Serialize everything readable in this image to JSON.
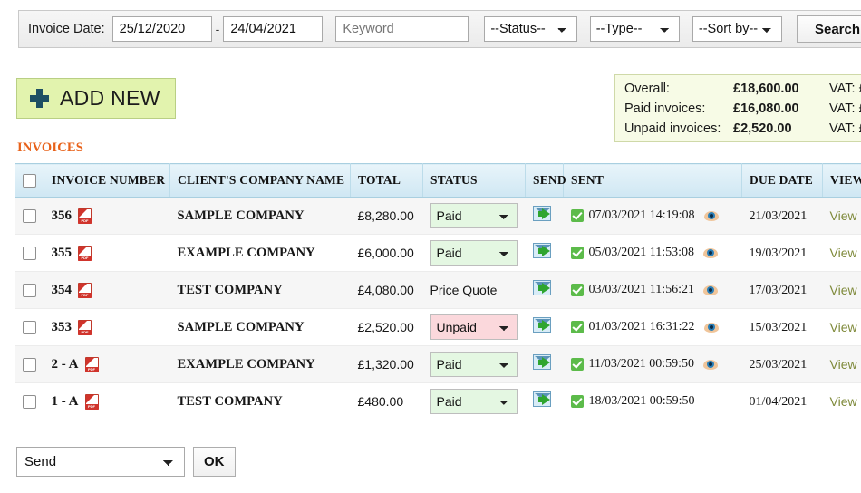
{
  "filters": {
    "invoice_date_label": "Invoice Date:",
    "date_from": "25/12/2020",
    "date_separator": "-",
    "date_to": "24/04/2021",
    "keyword_placeholder": "Keyword",
    "keyword_value": "",
    "status_select": "--Status--",
    "type_select": "--Type--",
    "sort_select": "--Sort by--",
    "search_button": "Search"
  },
  "add_new": {
    "label": "ADD NEW",
    "icon": "plus-icon"
  },
  "totals": {
    "rows": [
      {
        "label": "Overall:",
        "amount": "£18,600.00",
        "vat": "VAT: £"
      },
      {
        "label": "Paid invoices:",
        "amount": "£16,080.00",
        "vat": "VAT: £"
      },
      {
        "label": "Unpaid invoices:",
        "amount": "£2,520.00",
        "vat": "VAT: £"
      }
    ]
  },
  "section_title": "INVOICES",
  "table": {
    "headers": [
      "",
      "INVOICE NUMBER",
      "CLIENT'S COMPANY NAME",
      "TOTAL",
      "STATUS",
      "SEND",
      "SENT",
      "DUE DATE",
      "VIEW"
    ],
    "rows": [
      {
        "number": "356",
        "company": "SAMPLE COMPANY",
        "total": "£8,280.00",
        "status": "Paid",
        "status_type": "select",
        "status_color": "#e4f7e2",
        "sent": "07/03/2021 14:19:08",
        "has_eye": true,
        "due_date": "21/03/2021",
        "view": "View"
      },
      {
        "number": "355",
        "company": "EXAMPLE COMPANY",
        "total": "£6,000.00",
        "status": "Paid",
        "status_type": "select",
        "status_color": "#e4f7e2",
        "sent": "05/03/2021 11:53:08",
        "has_eye": true,
        "due_date": "19/03/2021",
        "view": "View"
      },
      {
        "number": "354",
        "company": "TEST COMPANY",
        "total": "£4,080.00",
        "status": "Price Quote",
        "status_type": "text",
        "status_color": "",
        "sent": "03/03/2021 11:56:21",
        "has_eye": true,
        "due_date": "17/03/2021",
        "view": "View"
      },
      {
        "number": "353",
        "company": "SAMPLE COMPANY",
        "total": "£2,520.00",
        "status": "Unpaid",
        "status_type": "select",
        "status_color": "#fbd8dc",
        "sent": "01/03/2021 16:31:22",
        "has_eye": true,
        "due_date": "15/03/2021",
        "view": "View"
      },
      {
        "number": "2 - A",
        "company": "EXAMPLE COMPANY",
        "total": "£1,320.00",
        "status": "Paid",
        "status_type": "select",
        "status_color": "#e4f7e2",
        "sent": "11/03/2021 00:59:50",
        "has_eye": true,
        "due_date": "25/03/2021",
        "view": "View"
      },
      {
        "number": "1 - A",
        "company": "TEST COMPANY",
        "total": "£480.00",
        "status": "Paid",
        "status_type": "select",
        "status_color": "#e4f7e2",
        "sent": "18/03/2021 00:59:50",
        "has_eye": false,
        "due_date": "01/04/2021",
        "view": "View"
      }
    ]
  },
  "bulk": {
    "action": "Send",
    "ok_button": "OK"
  },
  "colors": {
    "accent_orange": "#e8621a",
    "add_new_bg": "#e2f3ae",
    "totals_bg": "#f7fbe6",
    "header_bg": "#cfe7f3",
    "paid_bg": "#e4f7e2",
    "unpaid_bg": "#fbd8dc",
    "view_link": "#7f8a3b"
  }
}
